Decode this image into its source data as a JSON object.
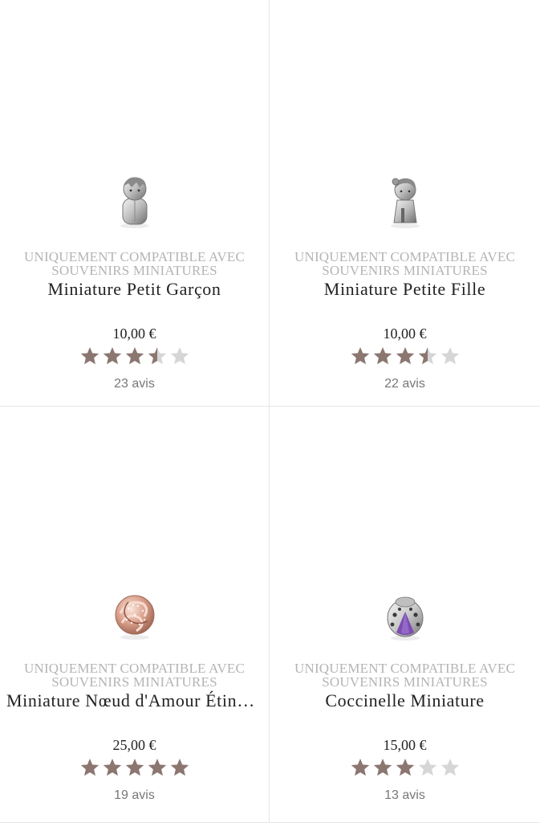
{
  "colors": {
    "star_filled": "#8c7670",
    "star_empty": "#d6d6d6",
    "compat_text": "#b4b4b4",
    "name_text": "#222222",
    "divider": "#e6e6e6"
  },
  "products": [
    {
      "compat_line1": "UNIQUEMENT COMPATIBLE AVEC",
      "compat_line2": "SOUVENIRS MINIATURES",
      "name": "Miniature Petit Garçon",
      "price": "10,00 €",
      "rating": 3.5,
      "reviews": "23 avis",
      "image_icon": "boy-charm-icon"
    },
    {
      "compat_line1": "UNIQUEMENT COMPATIBLE AVEC",
      "compat_line2": "SOUVENIRS MINIATURES",
      "name": "Miniature Petite Fille",
      "price": "10,00 €",
      "rating": 3.5,
      "reviews": "22 avis",
      "image_icon": "girl-charm-icon"
    },
    {
      "compat_line1": "UNIQUEMENT COMPATIBLE AVEC",
      "compat_line2": "SOUVENIRS MINIATURES",
      "name": "Miniature Nœud d'Amour Étincelant",
      "price": "25,00 €",
      "rating": 5,
      "reviews": "19 avis",
      "image_icon": "love-knot-charm-icon"
    },
    {
      "compat_line1": "UNIQUEMENT COMPATIBLE AVEC",
      "compat_line2": "SOUVENIRS MINIATURES",
      "name": "Coccinelle Miniature",
      "price": "15,00 €",
      "rating": 3,
      "reviews": "13 avis",
      "image_icon": "ladybug-charm-icon"
    }
  ]
}
